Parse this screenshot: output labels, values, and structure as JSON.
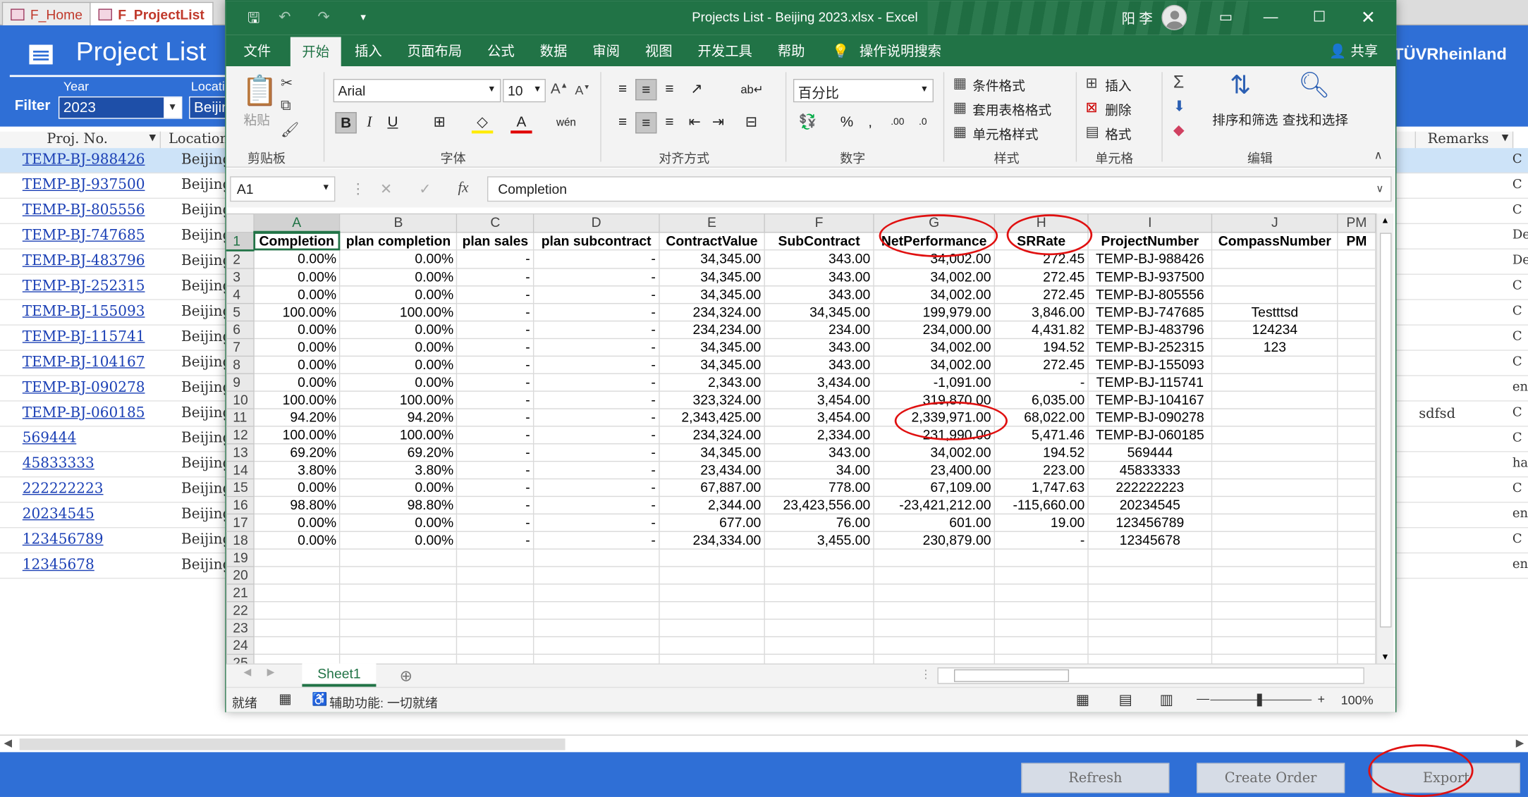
{
  "access": {
    "tabs": [
      "F_Home",
      "F_ProjectList"
    ],
    "title": "Project List",
    "brand": "TÜVRheinland",
    "filter_label": "Filter",
    "year_label": "Year",
    "year_value": "2023",
    "location_label": "Location",
    "location_value": "Beijing",
    "columns": {
      "proj_no": "Proj. No.",
      "location": "Location",
      "remarks": "Remarks"
    },
    "rows": [
      {
        "proj": "TEMP-BJ-988426",
        "loc": "Beijing",
        "rem": "C"
      },
      {
        "proj": "TEMP-BJ-937500",
        "loc": "Beijing",
        "rem": "C"
      },
      {
        "proj": "TEMP-BJ-805556",
        "loc": "Beijing",
        "rem": "C"
      },
      {
        "proj": "TEMP-BJ-747685",
        "loc": "Beijing",
        "rem": "De"
      },
      {
        "proj": "TEMP-BJ-483796",
        "loc": "Beijing",
        "rem": "De"
      },
      {
        "proj": "TEMP-BJ-252315",
        "loc": "Beijing",
        "rem": "C"
      },
      {
        "proj": "TEMP-BJ-155093",
        "loc": "Beijing",
        "rem": "C"
      },
      {
        "proj": "TEMP-BJ-115741",
        "loc": "Beijing",
        "rem": "C"
      },
      {
        "proj": "TEMP-BJ-104167",
        "loc": "Beijing",
        "rem": "C"
      },
      {
        "proj": "TEMP-BJ-090278",
        "loc": "Beijing",
        "rem": "en"
      },
      {
        "proj": "TEMP-BJ-060185",
        "loc": "Beijing",
        "rem": "C"
      },
      {
        "proj": "569444",
        "loc": "Beijing",
        "rem": "C"
      },
      {
        "proj": "45833333",
        "loc": "Beijing",
        "rem": "ha"
      },
      {
        "proj": "222222223",
        "loc": "Beijing",
        "rem": "C"
      },
      {
        "proj": "20234545",
        "loc": "Beijing",
        "rem": "en"
      },
      {
        "proj": "123456789",
        "loc": "Beijing",
        "rem": "C"
      },
      {
        "proj": "12345678",
        "loc": "Beijing",
        "rem": "en"
      }
    ],
    "remarks_value": "sdfsd",
    "buttons": {
      "refresh": "Refresh",
      "create_order": "Create Order",
      "export": "Export"
    }
  },
  "excel": {
    "window_title": "Projects List - Beijing 2023.xlsx  -  Excel",
    "user": "阳 李",
    "menu": [
      "文件",
      "开始",
      "插入",
      "页面布局",
      "公式",
      "数据",
      "审阅",
      "视图",
      "开发工具",
      "帮助"
    ],
    "tell_me": "操作说明搜索",
    "share": "共享",
    "ribbon": {
      "paste": "粘贴",
      "clipboard": "剪贴板",
      "font_name": "Arial",
      "font_size": "10",
      "font_group": "字体",
      "align_group": "对齐方式",
      "number_format": "百分比",
      "number_group": "数字",
      "cond_format": "条件格式",
      "table_format": "套用表格格式",
      "cell_style": "单元格样式",
      "styles_group": "样式",
      "insert": "插入",
      "delete": "删除",
      "format": "格式",
      "cells_group": "单元格",
      "sort_filter": "排序和筛选",
      "find_select": "查找和选择",
      "editing_group": "编辑"
    },
    "name_box": "A1",
    "formula": "Completion",
    "col_letters": [
      "A",
      "B",
      "C",
      "D",
      "E",
      "F",
      "G",
      "H",
      "I",
      "J",
      "PM"
    ],
    "header": [
      "Completion",
      "plan completion",
      "plan sales",
      "plan subcontract",
      "ContractValue",
      "SubContract",
      "NetPerformance",
      "SRRate",
      "ProjectNumber",
      "CompassNumber",
      "PM"
    ],
    "rows": [
      [
        "0.00%",
        "0.00%",
        "-",
        "-",
        "34,345.00",
        "343.00",
        "34,002.00",
        "272.45",
        "TEMP-BJ-988426",
        "",
        ""
      ],
      [
        "0.00%",
        "0.00%",
        "-",
        "-",
        "34,345.00",
        "343.00",
        "34,002.00",
        "272.45",
        "TEMP-BJ-937500",
        "",
        ""
      ],
      [
        "0.00%",
        "0.00%",
        "-",
        "-",
        "34,345.00",
        "343.00",
        "34,002.00",
        "272.45",
        "TEMP-BJ-805556",
        "",
        ""
      ],
      [
        "100.00%",
        "100.00%",
        "-",
        "-",
        "234,324.00",
        "34,345.00",
        "199,979.00",
        "3,846.00",
        "TEMP-BJ-747685",
        "Testttsd",
        ""
      ],
      [
        "0.00%",
        "0.00%",
        "-",
        "-",
        "234,234.00",
        "234.00",
        "234,000.00",
        "4,431.82",
        "TEMP-BJ-483796",
        "124234",
        ""
      ],
      [
        "0.00%",
        "0.00%",
        "-",
        "-",
        "34,345.00",
        "343.00",
        "34,002.00",
        "194.52",
        "TEMP-BJ-252315",
        "123",
        ""
      ],
      [
        "0.00%",
        "0.00%",
        "-",
        "-",
        "34,345.00",
        "343.00",
        "34,002.00",
        "272.45",
        "TEMP-BJ-155093",
        "",
        ""
      ],
      [
        "0.00%",
        "0.00%",
        "-",
        "-",
        "2,343.00",
        "3,434.00",
        "-1,091.00",
        "-",
        "TEMP-BJ-115741",
        "",
        ""
      ],
      [
        "100.00%",
        "100.00%",
        "-",
        "-",
        "323,324.00",
        "3,454.00",
        "319,870.00",
        "6,035.00",
        "TEMP-BJ-104167",
        "",
        ""
      ],
      [
        "94.20%",
        "94.20%",
        "-",
        "-",
        "2,343,425.00",
        "3,454.00",
        "2,339,971.00",
        "68,022.00",
        "TEMP-BJ-090278",
        "",
        ""
      ],
      [
        "100.00%",
        "100.00%",
        "-",
        "-",
        "234,324.00",
        "2,334.00",
        "231,990.00",
        "5,471.46",
        "TEMP-BJ-060185",
        "",
        ""
      ],
      [
        "69.20%",
        "69.20%",
        "-",
        "-",
        "34,345.00",
        "343.00",
        "34,002.00",
        "194.52",
        "569444",
        "",
        ""
      ],
      [
        "3.80%",
        "3.80%",
        "-",
        "-",
        "23,434.00",
        "34.00",
        "23,400.00",
        "223.00",
        "45833333",
        "",
        ""
      ],
      [
        "0.00%",
        "0.00%",
        "-",
        "-",
        "67,887.00",
        "778.00",
        "67,109.00",
        "1,747.63",
        "222222223",
        "",
        ""
      ],
      [
        "98.80%",
        "98.80%",
        "-",
        "-",
        "2,344.00",
        "23,423,556.00",
        "-23,421,212.00",
        "-115,660.00",
        "20234545",
        "",
        ""
      ],
      [
        "0.00%",
        "0.00%",
        "-",
        "-",
        "677.00",
        "76.00",
        "601.00",
        "19.00",
        "123456789",
        "",
        ""
      ],
      [
        "0.00%",
        "0.00%",
        "-",
        "-",
        "234,334.00",
        "3,455.00",
        "230,879.00",
        "-",
        "12345678",
        "",
        ""
      ]
    ],
    "empty_rows": [
      "19",
      "20",
      "21",
      "22",
      "23",
      "24",
      "25"
    ],
    "sheet_tab": "Sheet1",
    "status": {
      "ready": "就绪",
      "accessibility": "辅助功能: 一切就绪",
      "zoom": "100%"
    }
  },
  "colors": {
    "excel_green": "#217346",
    "access_blue": "#2f6fd6",
    "annotation_red": "#e01010"
  }
}
